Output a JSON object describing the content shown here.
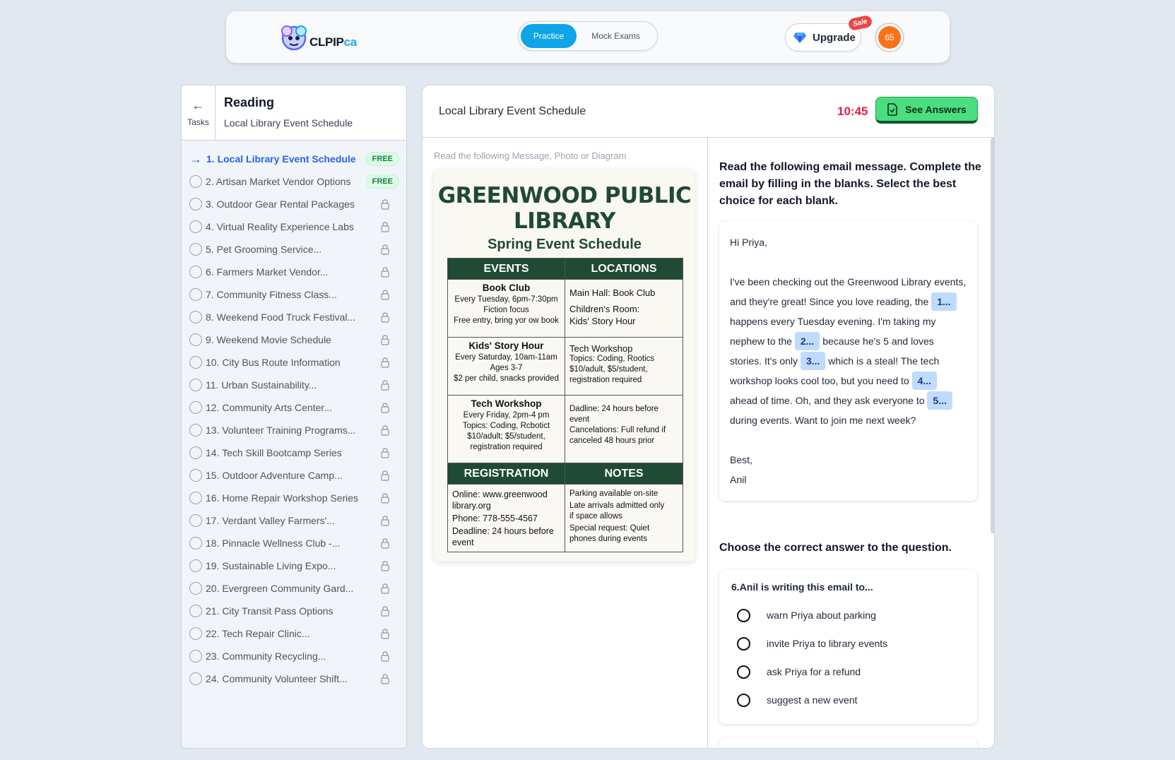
{
  "header": {
    "logo_text": "CLPIP",
    "logo_suffix": "ca",
    "tab_practice": "Practice",
    "tab_mock": "Mock Exams",
    "upgrade_label": "Upgrade",
    "sale_badge": "Sale",
    "avatar_initials": "65",
    "accent_color": "#0ea5e9"
  },
  "sidebar": {
    "back_label": "Tasks",
    "section_title": "Reading",
    "section_subtitle": "Local Library Event Schedule",
    "free_label": "FREE",
    "tasks": [
      {
        "label": "1. Local Library Event Schedule",
        "status": "current"
      },
      {
        "label": "2. Artisan Market Vendor Options",
        "status": "free"
      },
      {
        "label": "3. Outdoor Gear Rental Packages",
        "status": "locked"
      },
      {
        "label": "4. Virtual Reality Experience Labs",
        "status": "locked"
      },
      {
        "label": "5. Pet Grooming Service...",
        "status": "locked"
      },
      {
        "label": "6. Farmers Market Vendor...",
        "status": "locked"
      },
      {
        "label": "7. Community Fitness Class...",
        "status": "locked"
      },
      {
        "label": "8. Weekend Food Truck Festival...",
        "status": "locked"
      },
      {
        "label": "9. Weekend Movie Schedule",
        "status": "locked"
      },
      {
        "label": "10. City Bus Route Information",
        "status": "locked"
      },
      {
        "label": "11. Urban Sustainability...",
        "status": "locked"
      },
      {
        "label": "12. Community Arts Center...",
        "status": "locked"
      },
      {
        "label": "13. Volunteer Training Programs...",
        "status": "locked"
      },
      {
        "label": "14. Tech Skill Bootcamp Series",
        "status": "locked"
      },
      {
        "label": "15. Outdoor Adventure Camp...",
        "status": "locked"
      },
      {
        "label": "16. Home Repair Workshop Series",
        "status": "locked"
      },
      {
        "label": "17. Verdant Valley Farmers'...",
        "status": "locked"
      },
      {
        "label": "18. Pinnacle Wellness Club -...",
        "status": "locked"
      },
      {
        "label": "19. Sustainable Living Expo...",
        "status": "locked"
      },
      {
        "label": "20. Evergreen Community Gard...",
        "status": "locked"
      },
      {
        "label": "21. City Transit Pass Options",
        "status": "locked"
      },
      {
        "label": "22. Tech Repair Clinic...",
        "status": "locked"
      },
      {
        "label": "23. Community Recycling...",
        "status": "locked"
      },
      {
        "label": "24. Community Volunteer Shift...",
        "status": "locked"
      }
    ]
  },
  "main": {
    "title": "Local Library Event Schedule",
    "timer": "10:45",
    "see_answers_label": "See Answers",
    "left_instruction": "Read the following Message, Photo or Diagram",
    "flyer": {
      "title_line1": "GREENWOOD PUBLIC",
      "title_line2": "LIBRARY",
      "subtitle": "Spring Event Schedule",
      "headers": {
        "events": "EVENTS",
        "locations": "LOCATIONS",
        "registration": "REGISTRATION",
        "notes": "NOTES"
      },
      "book_club": {
        "name": "Book Club",
        "l1": "Every Tuesday, 6pm-7:30pm",
        "l2": "Fiction focus",
        "l3": "Free entry, bring yor ow book"
      },
      "loc1": {
        "l1": "Main Hall: Book Club",
        "l2": "Children's Room:",
        "l3": "Kids' Story Hour"
      },
      "kids": {
        "name": "Kids' Story Hour",
        "l1": "Every Saturday, 10am-11am",
        "l2": "Ages 3-7",
        "l3": "$2 per child, snacks provided"
      },
      "loc2": {
        "l1": "Tech Workshop",
        "l2": "Topics: Coding, Rootics",
        "l3": "$10/adult, $5/student,",
        "l4": "registration required"
      },
      "tech": {
        "name": "Tech Workshop",
        "l1": "Every Friday, 2pm-4 pm",
        "l2": "Topics: Coding, Rcbotict",
        "l3": "$10/adult; $5/student,",
        "l4": "registration required"
      },
      "loc3": {
        "l1": "Dadline: 24 hours before",
        "l2": "event",
        "l3": "Cancelations: Full refund if",
        "l4": "canceled 48 hours prior"
      },
      "reg": {
        "l1": "Online: www.greenwood",
        "l2": "library.org",
        "l3": "Phone: 778-555-4567",
        "l4": "Deadline: 24 hours before",
        "l5": "event"
      },
      "notes": {
        "l1": "Parking available on-site",
        "l2": "Late arrivals admitted only",
        "l3": "if space allows",
        "l4": "Special request: Quiet",
        "l5": "phones during events"
      }
    },
    "question_instruction": "Read the following email message. Complete the email by filling in the blanks. Select the best choice for each blank.",
    "email": {
      "greeting": "Hi Priya,",
      "s1": "I've been checking out the Greenwood Library events, and they're great! Since you love reading, the",
      "b1": "1...",
      "s2": "happens every Tuesday evening. I'm taking my nephew to the",
      "b2": "2...",
      "s3": "because he's 5 and loves stories. It's only",
      "b3": "3...",
      "s4": "which is a steal! The tech workshop looks cool too, but you need to",
      "b4": "4...",
      "s5": "ahead of time. Oh, and they ask everyone to",
      "b5": "5...",
      "s6": "during events. Want to join me next week?",
      "signoff": "Best,",
      "name": "Anil"
    },
    "mcq_instruction": "Choose the correct answer to the question.",
    "mcq": {
      "stem": "6.Anil is writing this email to...",
      "options": [
        "warn Priya about parking",
        "invite Priya to library events",
        "ask Priya for a refund",
        "suggest a new event"
      ]
    }
  }
}
